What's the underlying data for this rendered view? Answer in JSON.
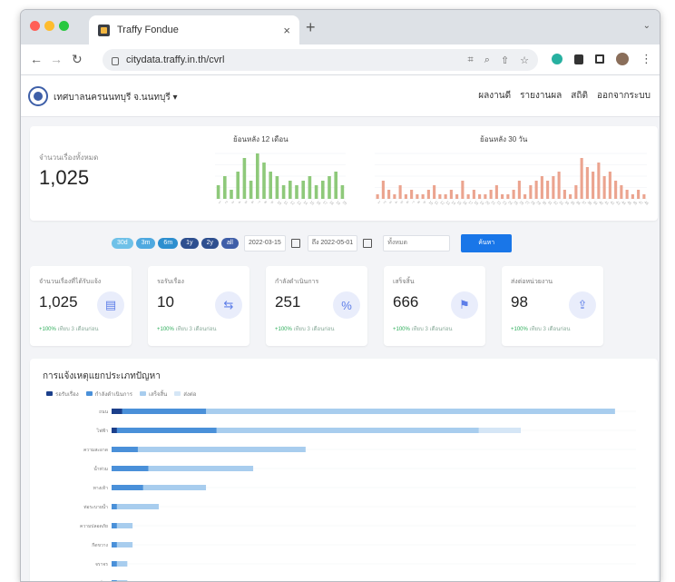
{
  "browser": {
    "tab_title": "Traffy Fondue",
    "url": "citydata.traffy.in.th/cvrl",
    "new_tab": "+",
    "close": "×"
  },
  "site": {
    "org_name": "เทศบาลนครนนทบุรี จ.นนทบุรี ▾",
    "nav": [
      "ผลงานดี",
      "รายงานผล",
      "สถิติ",
      "ออกจากระบบ"
    ]
  },
  "hero": {
    "label": "จำนวนเรื่องทั้งหมด",
    "value": "1,025",
    "chart1_title": "ย้อนหลัง 12 เดือน",
    "chart2_title": "ย้อนหลัง 30 วัน",
    "chart1_color": "#8ec97a",
    "chart2_color": "#eba48f"
  },
  "filters": {
    "pills": [
      {
        "label": "30d",
        "color": "#6fc1e8"
      },
      {
        "label": "3m",
        "color": "#4fa9e0"
      },
      {
        "label": "6m",
        "color": "#2e8fcf"
      },
      {
        "label": "1y",
        "color": "#2e4f8f"
      },
      {
        "label": "2y",
        "color": "#2e4f8f"
      },
      {
        "label": "all",
        "color": "#3f5ea8"
      }
    ],
    "date_from": "2022-03-15",
    "date_to": "ถึง 2022-05-01",
    "select_placeholder": "ทั้งหมด",
    "search_label": "ค้นหา"
  },
  "stats": [
    {
      "label": "จำนวนเรื่องที่ได้รับแจ้ง",
      "value": "1,025",
      "sub_pct": "+100%",
      "sub_text": "เทียบ 3 เดือนก่อน",
      "icon": "document-icon",
      "glyph": "▤"
    },
    {
      "label": "รอรับเรื่อง",
      "value": "10",
      "sub_pct": "+100%",
      "sub_text": "เทียบ 3 เดือนก่อน",
      "icon": "transfer-icon",
      "glyph": "⇆"
    },
    {
      "label": "กำลังดำเนินการ",
      "value": "251",
      "sub_pct": "+100%",
      "sub_text": "เทียบ 3 เดือนก่อน",
      "icon": "percent-icon",
      "glyph": "%"
    },
    {
      "label": "เสร็จสิ้น",
      "value": "666",
      "sub_pct": "+100%",
      "sub_text": "เทียบ 3 เดือนก่อน",
      "icon": "flag-icon",
      "glyph": "⚑"
    },
    {
      "label": "ส่งต่อหน่วยงาน",
      "value": "98",
      "sub_pct": "+100%",
      "sub_text": "เทียบ 3 เดือนก่อน",
      "icon": "forward-icon",
      "glyph": "⇪"
    }
  ],
  "bar_list": {
    "title": "การแจ้งเหตุแยกประเภทปัญหา",
    "legend": [
      {
        "label": "รอรับเรื่อง",
        "color": "#1b3f8b"
      },
      {
        "label": "กำลังดำเนินการ",
        "color": "#4a90d9"
      },
      {
        "label": "เสร็จสิ้น",
        "color": "#a8cdee"
      },
      {
        "label": "ส่งต่อ",
        "color": "#d5e6f6"
      }
    ]
  },
  "chart_data": [
    {
      "type": "bar",
      "title": "ย้อนหลัง 12 เดือน",
      "categories": [
        "1",
        "2",
        "3",
        "4",
        "5",
        "6",
        "7",
        "8",
        "9",
        "10",
        "11",
        "12",
        "13",
        "14",
        "15",
        "16",
        "17",
        "18",
        "19",
        "20"
      ],
      "values": [
        3,
        5,
        2,
        6,
        9,
        4,
        10,
        8,
        6,
        5,
        3,
        4,
        3,
        4,
        5,
        3,
        4,
        5,
        6,
        3
      ],
      "ylim": [
        0,
        10
      ]
    },
    {
      "type": "bar",
      "title": "ย้อนหลัง 30 วัน",
      "categories": [
        "1",
        "2",
        "3",
        "4",
        "5",
        "6",
        "7",
        "8",
        "9",
        "10",
        "11",
        "12",
        "13",
        "14",
        "15",
        "16",
        "17",
        "18",
        "19",
        "20",
        "21",
        "22",
        "23",
        "24",
        "25",
        "26",
        "27",
        "28",
        "29",
        "30",
        "31",
        "32",
        "33",
        "34",
        "35",
        "36",
        "37",
        "38",
        "39",
        "40",
        "41",
        "42",
        "43",
        "44",
        "45",
        "46",
        "47",
        "48"
      ],
      "values": [
        1,
        4,
        2,
        1,
        3,
        1,
        2,
        1,
        1,
        2,
        3,
        1,
        1,
        2,
        1,
        4,
        1,
        2,
        1,
        1,
        2,
        3,
        1,
        1,
        2,
        4,
        1,
        3,
        4,
        5,
        4,
        5,
        6,
        2,
        1,
        3,
        9,
        7,
        6,
        8,
        5,
        6,
        4,
        3,
        2,
        1,
        2,
        1
      ],
      "ylim": [
        0,
        10
      ]
    },
    {
      "type": "bar",
      "title": "การแจ้งเหตุแยกประเภทปัญหา",
      "categories": [
        "ถนน",
        "ไฟฟ้า",
        "ความสะอาด",
        "น้ำท่วม",
        "ทางเท้า",
        "ท่อระบายน้ำ",
        "ความปลอดภัย",
        "กีดขวาง",
        "จราจร",
        "อื่นๆ"
      ],
      "series": [
        {
          "name": "รอรับเรื่อง",
          "values": [
            2,
            1,
            0,
            0,
            0,
            0,
            0,
            0,
            0,
            0
          ]
        },
        {
          "name": "กำลังดำเนินการ",
          "values": [
            18,
            20,
            5,
            7,
            6,
            1,
            1,
            1,
            1,
            1
          ]
        },
        {
          "name": "เสร็จสิ้น",
          "values": [
            78,
            50,
            32,
            20,
            12,
            8,
            3,
            3,
            2,
            2
          ]
        },
        {
          "name": "ส่งต่อ",
          "values": [
            0,
            8,
            0,
            0,
            0,
            0,
            0,
            0,
            0,
            0
          ]
        }
      ],
      "xlim": [
        0,
        100
      ]
    }
  ]
}
